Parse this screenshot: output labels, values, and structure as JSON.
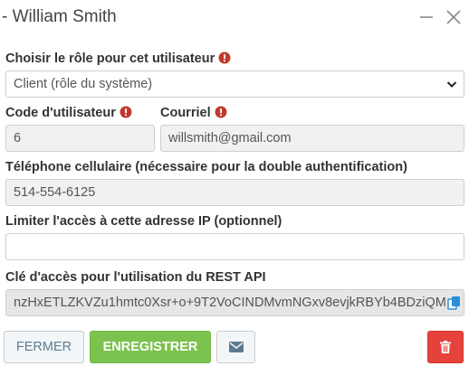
{
  "dialog": {
    "title": "- William Smith"
  },
  "form": {
    "role": {
      "label": "Choisir le rôle pour cet utilisateur",
      "value": "Client (rôle du système)"
    },
    "user_code": {
      "label": "Code d'utilisateur",
      "value": "6"
    },
    "email": {
      "label": "Courriel",
      "value": "willsmith@gmail.com"
    },
    "phone": {
      "label": "Téléphone cellulaire (nécessaire pour la double authentification)",
      "value": "514-554-6125"
    },
    "ip": {
      "label": "Limiter l'accès à cette adresse IP (optionnel)",
      "value": ""
    },
    "api_key": {
      "label": "Clé d'accès pour l'utilisation du REST API",
      "value": "nzHxETLZKVZu1hmtc0Xsr+o+9T2VoCINDMvmNGxv8evjkRBYb4BDziQM"
    }
  },
  "buttons": {
    "close_label": "FERMER",
    "save_label": "ENREGISTRER"
  },
  "icons": {
    "minimize": "minimize-icon",
    "close": "close-icon",
    "required": "exclamation-circle-icon",
    "copy": "copy-icon",
    "mail": "envelope-icon",
    "delete": "trash-icon"
  },
  "colors": {
    "required": "#c0392b",
    "save_button": "#7cc24f",
    "delete_button": "#e4423b",
    "close_text": "#5e7c91",
    "copy_icon": "#2a8fd6"
  }
}
